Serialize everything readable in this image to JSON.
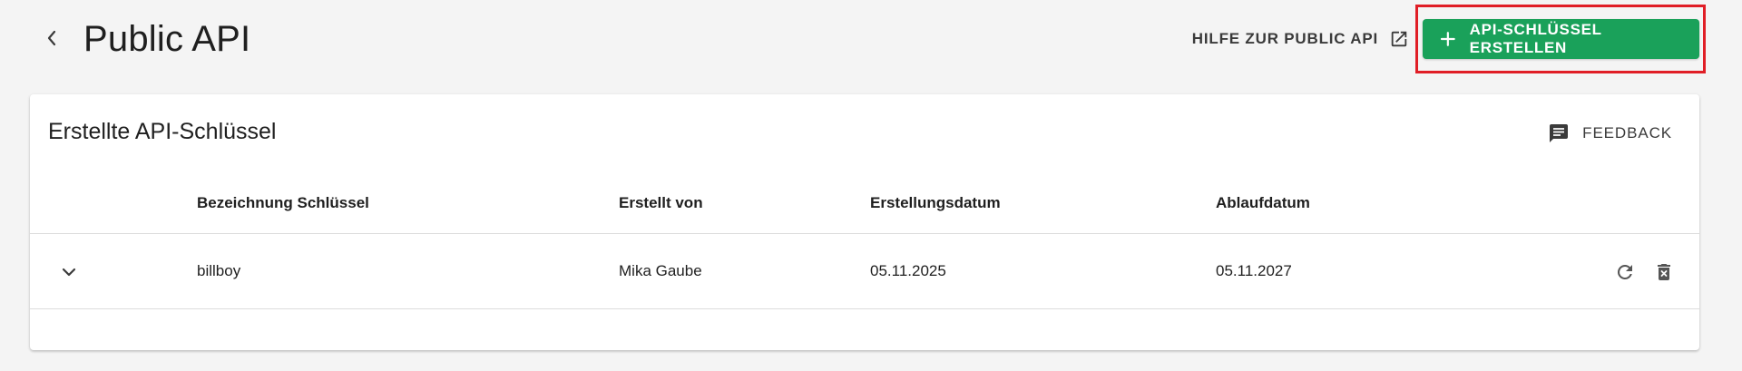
{
  "header": {
    "title": "Public API",
    "help_link_label": "HILFE ZUR PUBLIC API",
    "create_button_label": "API-SCHLÜSSEL ERSTELLEN"
  },
  "card": {
    "title": "Erstellte API-Schlüssel",
    "feedback_label": "FEEDBACK"
  },
  "table": {
    "columns": [
      "Bezeichnung Schlüssel",
      "Erstellt von",
      "Erstellungsdatum",
      "Ablaufdatum"
    ],
    "rows": [
      {
        "name": "billboy",
        "created_by": "Mika Gaube",
        "created_on": "05.11.2025",
        "expires_on": "05.11.2027"
      }
    ]
  },
  "colors": {
    "accent": "#1aa15a",
    "highlight_frame": "#e01e26",
    "background": "#f4f4f4"
  },
  "icons": {
    "back": "chevron-left-icon",
    "external": "open-in-new-icon",
    "add": "plus-icon",
    "feedback": "feedback-message-icon",
    "expand": "chevron-down-icon",
    "refresh": "refresh-icon",
    "delete": "delete-x-icon"
  }
}
